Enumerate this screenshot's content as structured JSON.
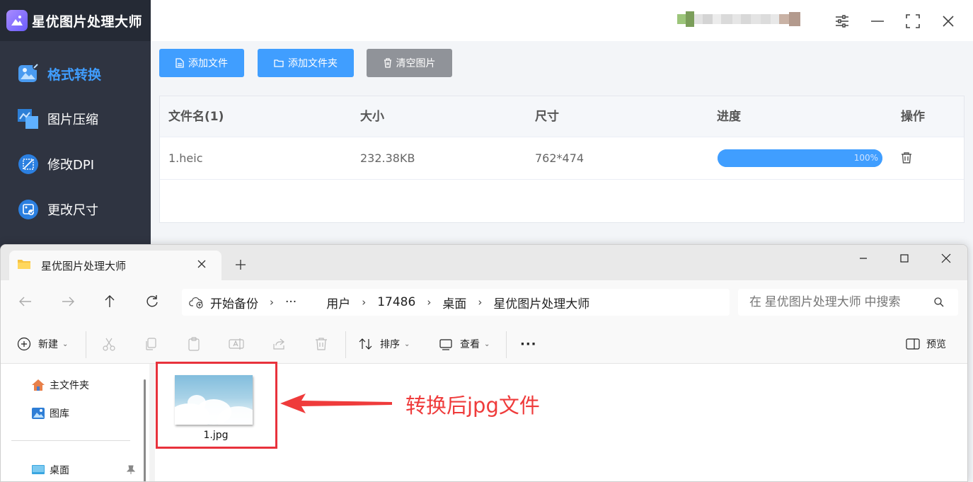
{
  "app": {
    "title": "星优图片处理大师",
    "sidebar": [
      {
        "label": "格式转换",
        "icon": "image-convert-icon",
        "active": true
      },
      {
        "label": "图片压缩",
        "icon": "image-compress-icon",
        "active": false
      },
      {
        "label": "修改DPI",
        "icon": "dpi-icon",
        "active": false
      },
      {
        "label": "更改尺寸",
        "icon": "resize-icon",
        "active": false
      }
    ],
    "toolbar": {
      "add_file": "添加文件",
      "add_folder": "添加文件夹",
      "clear": "清空图片"
    },
    "table": {
      "headers": [
        "文件名(1)",
        "大小",
        "尺寸",
        "进度",
        "操作"
      ],
      "rows": [
        {
          "name": "1.heic",
          "size": "232.38KB",
          "dimensions": "762*474",
          "progress_text": "100%",
          "progress": 1.0
        }
      ]
    },
    "colors": {
      "accent": "#409eff",
      "sidebar": "#2f3441",
      "gray_button": "#909399"
    }
  },
  "explorer": {
    "tab_title": "星优图片处理大师",
    "breadcrumb": [
      "开始备份",
      "···",
      "用户",
      "17486",
      "桌面",
      "星优图片处理大师"
    ],
    "search_placeholder": "在 星优图片处理大师 中搜索",
    "commands": {
      "new": "新建",
      "sort": "排序",
      "view": "查看",
      "more": "···",
      "preview": "预览"
    },
    "nav_items": [
      {
        "label": "主文件夹",
        "icon": "home-icon"
      },
      {
        "label": "图库",
        "icon": "gallery-icon"
      },
      {
        "label": "桌面",
        "icon": "desktop-icon"
      }
    ],
    "files": [
      {
        "name": "1.jpg"
      }
    ]
  },
  "annotation": {
    "text": "转换后jpg文件",
    "color": "#e8323c"
  }
}
